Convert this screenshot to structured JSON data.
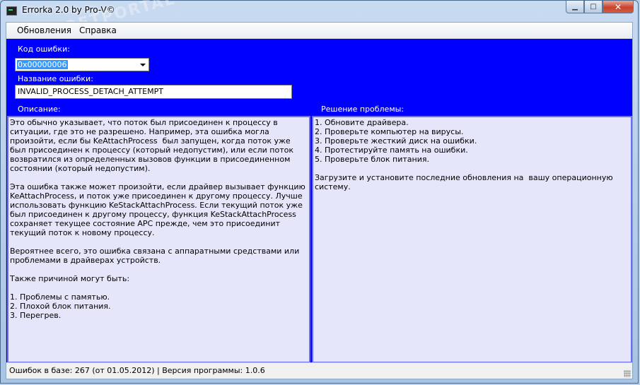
{
  "window": {
    "title": "Errorka 2.0 by Pro-V©",
    "minimize_glyph": "▁",
    "maximize_glyph": "□",
    "close_glyph": "✕"
  },
  "menu": {
    "items": [
      "Обновления",
      "Справка"
    ]
  },
  "watermark": "SOFTPORTAL",
  "form": {
    "error_code_label": "Код ошибки:",
    "error_code_value": "0x00000006",
    "error_name_label": "Название ошибки:",
    "error_name_value": "INVALID_PROCESS_DETACH_ATTEMPT",
    "description_label": "Описание:",
    "solution_label": "Решение проблемы:"
  },
  "description_text": "Это обычно указывает, что поток был присоединен к процессу в ситуации, где это не разрешено. Например, эта ошибка могла произойти, если бы KeAttachProcess  был запущен, когда поток уже был присоединен к процессу (который недопустим), или если поток возвратился из определенных вызовов функции в присоединенном состоянии (который недопустим).\n\nЭта ошибка также может произойти, если драйвер вызывает функцию KeAttachProcess, и поток уже присоединен к другому процессу. Лучше использовать функцию KeStackAttachProcess. Если текущий поток уже был присоединен к другому процессу, функция KeStackAttachProcess сохраняет текущее состояние APC прежде, чем это присоединит текущий поток к новому процессу.\n\nВероятнее всего, это ошибка связана с аппаратными средствами или проблемами в драйверах устройств.\n\nТакже причиной могут быть:\n\n1. Проблемы с памятью.\n2. Плохой блок питания.\n3. Перегрев.",
  "solution_text": "1. Обновите драйвера.\n2. Проверьте компьютер на вирусы.\n3. Проверьте жесткий диск на ошибки.\n4. Протестируйте память на ошибки.\n5. Проверьте блок питания.\n\nЗагрузите и установите последние обновления на  вашу операционную систему.",
  "status": {
    "text": "Ошибок в базе: 267 (от 01.05.2012) | Версия программы: 1.0.6"
  },
  "colors": {
    "panel_blue": "#0000ff",
    "textarea_bg": "#e6e6fa"
  }
}
